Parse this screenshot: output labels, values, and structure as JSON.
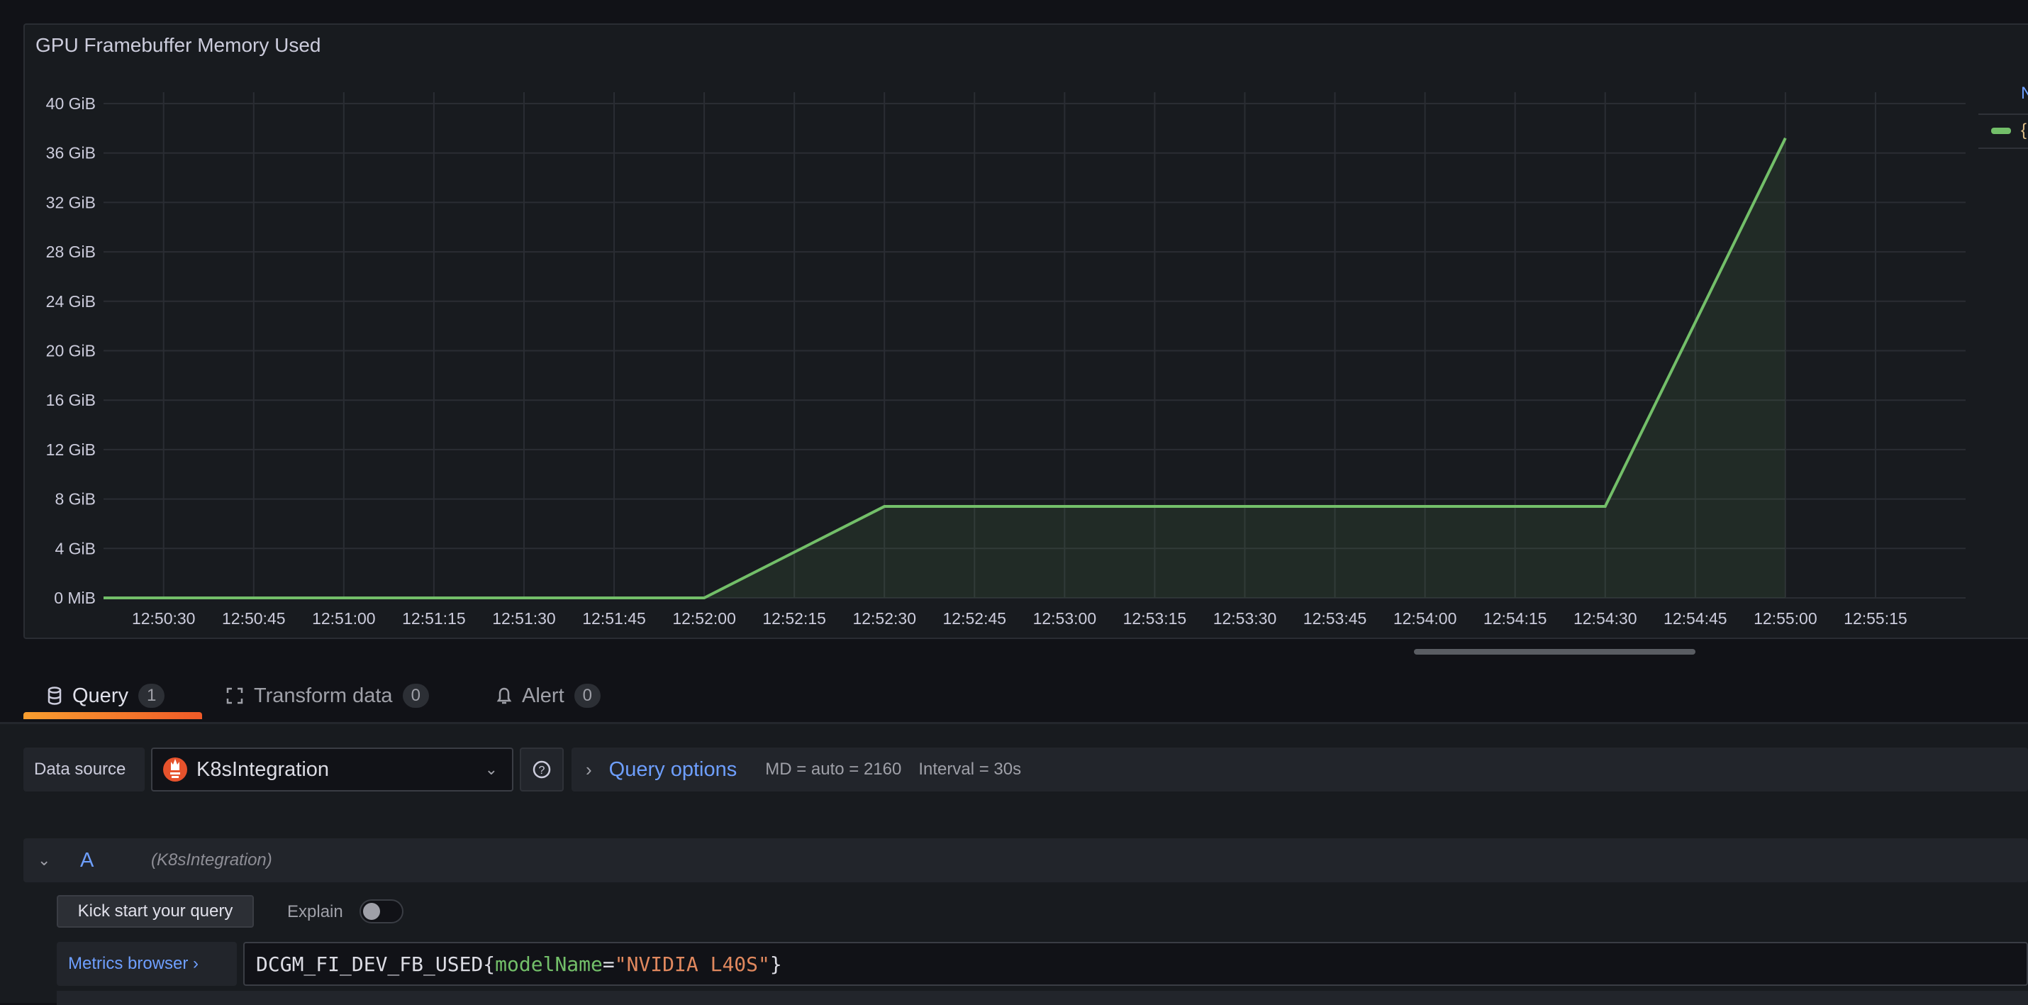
{
  "panel": {
    "title": "GPU Framebuffer Memory Used",
    "legend_header": "N",
    "legend_entry": "{"
  },
  "chart_data": {
    "type": "area",
    "title": "GPU Framebuffer Memory Used",
    "x_ticks": [
      "12:50:30",
      "12:50:45",
      "12:51:00",
      "12:51:15",
      "12:51:30",
      "12:51:45",
      "12:52:00",
      "12:52:15",
      "12:52:30",
      "12:52:45",
      "12:53:00",
      "12:53:15",
      "12:53:30",
      "12:53:45",
      "12:54:00",
      "12:54:15",
      "12:54:30",
      "12:54:45",
      "12:55:00",
      "12:55:15"
    ],
    "y_ticks": [
      "0 MiB",
      "4 GiB",
      "8 GiB",
      "12 GiB",
      "16 GiB",
      "20 GiB",
      "24 GiB",
      "28 GiB",
      "32 GiB",
      "36 GiB",
      "40 GiB"
    ],
    "ylim_gib": [
      0,
      40
    ],
    "xlim": [
      "12:50:20",
      "12:55:30"
    ],
    "grid": true,
    "legend_placement": "right",
    "series": [
      {
        "color": "#73bf69",
        "x": [
          "12:50:20",
          "12:52:00",
          "12:52:30",
          "12:54:30",
          "12:55:00"
        ],
        "y_gib": [
          0,
          0,
          7.4,
          7.4,
          37.2
        ]
      }
    ]
  },
  "tabs": [
    {
      "label": "Query",
      "count": "1",
      "icon": "database-icon"
    },
    {
      "label": "Transform data",
      "count": "0",
      "icon": "transform-icon"
    },
    {
      "label": "Alert",
      "count": "0",
      "icon": "bell-icon"
    }
  ],
  "datasource": {
    "label": "Data source",
    "value": "K8sIntegration",
    "icon": "prometheus-icon"
  },
  "query_options": {
    "title": "Query options",
    "md": "MD = auto = 2160",
    "interval": "Interval = 30s"
  },
  "query_a": {
    "ref": "A",
    "datasource": "(K8sIntegration)",
    "kick_start": "Kick start your query",
    "explain": "Explain",
    "explain_on": false,
    "metrics_browser": "Metrics browser ›",
    "code": {
      "metric": "DCGM_FI_DEV_FB_USED",
      "open": "{",
      "label": "modelName",
      "eq": "=",
      "value": "\"NVIDIA L40S\"",
      "close": "}"
    }
  },
  "colors": {
    "accent": "#6e9fff",
    "series": "#73bf69",
    "tab_active": "#f05a28"
  }
}
